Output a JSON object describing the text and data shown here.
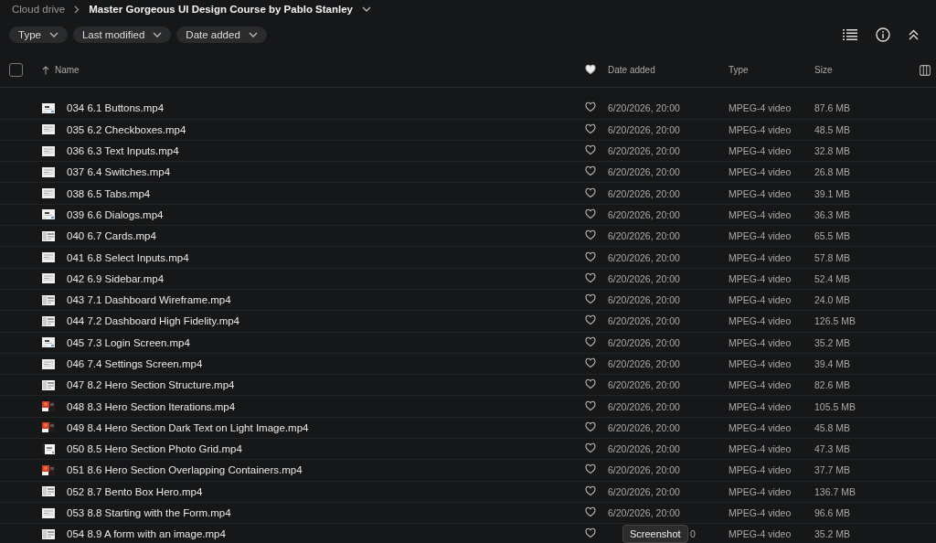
{
  "breadcrumb": [
    {
      "label": "Cloud drive",
      "current": false
    },
    {
      "label": "Master Gorgeous UI Design Course by Pablo Stanley",
      "current": true
    }
  ],
  "filters": [
    "Type",
    "Last modified",
    "Date added"
  ],
  "select_all_checked": false,
  "columns": {
    "name": "Name",
    "date_added": "Date added",
    "type": "Type",
    "size": "Size"
  },
  "rows": [
    {
      "name": "034 6.1 Buttons.mp4",
      "favorite": false,
      "date_added": "6/20/2026, 20:00",
      "type": "MPEG-4 video",
      "size": "87.6 MB"
    },
    {
      "name": "035 6.2 Checkboxes.mp4",
      "favorite": false,
      "date_added": "6/20/2026, 20:00",
      "type": "MPEG-4 video",
      "size": "48.5 MB"
    },
    {
      "name": "036 6.3 Text Inputs.mp4",
      "favorite": false,
      "date_added": "6/20/2026, 20:00",
      "type": "MPEG-4 video",
      "size": "32.8 MB"
    },
    {
      "name": "037 6.4 Switches.mp4",
      "favorite": false,
      "date_added": "6/20/2026, 20:00",
      "type": "MPEG-4 video",
      "size": "26.8 MB"
    },
    {
      "name": "038 6.5 Tabs.mp4",
      "favorite": false,
      "date_added": "6/20/2026, 20:00",
      "type": "MPEG-4 video",
      "size": "39.1 MB"
    },
    {
      "name": "039 6.6 Dialogs.mp4",
      "favorite": false,
      "date_added": "6/20/2026, 20:00",
      "type": "MPEG-4 video",
      "size": "36.3 MB"
    },
    {
      "name": "040 6.7 Cards.mp4",
      "favorite": false,
      "date_added": "6/20/2026, 20:00",
      "type": "MPEG-4 video",
      "size": "65.5 MB"
    },
    {
      "name": "041 6.8 Select Inputs.mp4",
      "favorite": false,
      "date_added": "6/20/2026, 20:00",
      "type": "MPEG-4 video",
      "size": "57.8 MB"
    },
    {
      "name": "042 6.9 Sidebar.mp4",
      "favorite": false,
      "date_added": "6/20/2026, 20:00",
      "type": "MPEG-4 video",
      "size": "52.4 MB"
    },
    {
      "name": "043 7.1 Dashboard Wireframe.mp4",
      "favorite": false,
      "date_added": "6/20/2026, 20:00",
      "type": "MPEG-4 video",
      "size": "24.0 MB"
    },
    {
      "name": "044 7.2 Dashboard High Fidelity.mp4",
      "favorite": false,
      "date_added": "6/20/2026, 20:00",
      "type": "MPEG-4 video",
      "size": "126.5 MB"
    },
    {
      "name": "045 7.3 Login Screen.mp4",
      "favorite": false,
      "date_added": "6/20/2026, 20:00",
      "type": "MPEG-4 video",
      "size": "35.2 MB"
    },
    {
      "name": "046 7.4 Settings Screen.mp4",
      "favorite": false,
      "date_added": "6/20/2026, 20:00",
      "type": "MPEG-4 video",
      "size": "39.4 MB"
    },
    {
      "name": "047 8.2 Hero Section Structure.mp4",
      "favorite": false,
      "date_added": "6/20/2026, 20:00",
      "type": "MPEG-4 video",
      "size": "82.6 MB"
    },
    {
      "name": "048 8.3 Hero Section Iterations.mp4",
      "favorite": false,
      "date_added": "6/20/2026, 20:00",
      "type": "MPEG-4 video",
      "size": "105.5 MB"
    },
    {
      "name": "049 8.4 Hero Section Dark Text on Light Image.mp4",
      "favorite": false,
      "date_added": "6/20/2026, 20:00",
      "type": "MPEG-4 video",
      "size": "45.8 MB"
    },
    {
      "name": "050 8.5 Hero Section Photo Grid.mp4",
      "favorite": false,
      "date_added": "6/20/2026, 20:00",
      "type": "MPEG-4 video",
      "size": "47.3 MB"
    },
    {
      "name": "051 8.6 Hero Section Overlapping Containers.mp4",
      "favorite": false,
      "date_added": "6/20/2026, 20:00",
      "type": "MPEG-4 video",
      "size": "37.7 MB"
    },
    {
      "name": "052 8.7 Bento Box Hero.mp4",
      "favorite": false,
      "date_added": "6/20/2026, 20:00",
      "type": "MPEG-4 video",
      "size": "136.7 MB"
    },
    {
      "name": "053 8.8 Starting with the Form.mp4",
      "favorite": false,
      "date_added": "6/20/2026, 20:00",
      "type": "MPEG-4 video",
      "size": "96.6 MB"
    },
    {
      "name": "054 8.9 A form with an image.mp4",
      "favorite": false,
      "date_added": "0",
      "type": "MPEG-4 video",
      "size": "35.2 MB"
    }
  ],
  "tooltip": "Screenshot"
}
